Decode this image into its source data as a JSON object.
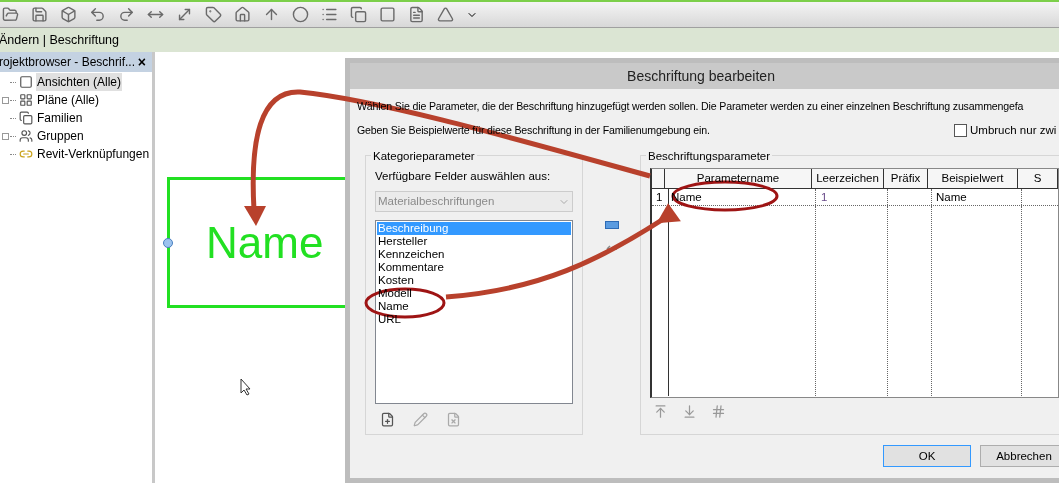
{
  "ribbon": {
    "context_tab": "Ändern | Beschriftung"
  },
  "project_browser": {
    "title": "rojektbrowser - Beschrif...",
    "close": "×",
    "items": [
      {
        "label": "Ansichten (Alle)",
        "kind": "views",
        "expandable": false,
        "selected": true
      },
      {
        "label": "Pläne (Alle)",
        "kind": "sheets",
        "expandable": true,
        "selected": false
      },
      {
        "label": "Familien",
        "kind": "families",
        "expandable": false,
        "selected": false
      },
      {
        "label": "Gruppen",
        "kind": "groups",
        "expandable": true,
        "selected": false
      },
      {
        "label": "Revit-Verknüpfungen",
        "kind": "links",
        "expandable": false,
        "selected": false
      }
    ]
  },
  "canvas": {
    "label_text": "Name"
  },
  "dialog": {
    "title": "Beschriftung bearbeiten",
    "instructions": [
      "Wählen Sie die Parameter, die der Beschriftung hinzugefügt werden sollen. Die Parameter werden zu einer einzelnen Beschriftung zusammengefa",
      "Geben Sie Beispielwerte für diese Beschriftung in der Familienumgebung ein."
    ],
    "wrap_checkbox": {
      "label": "Umbruch nur zwi",
      "checked": false
    },
    "category_parameters": {
      "title": "Kategorieparameter",
      "dropdown_label": "Verfügbare Felder auswählen aus:",
      "dropdown": {
        "value": "Materialbeschriftungen",
        "disabled": true
      },
      "fields": [
        {
          "label": "Beschreibung",
          "selected": true
        },
        {
          "label": "Hersteller",
          "selected": false
        },
        {
          "label": "Kennzeichen",
          "selected": false
        },
        {
          "label": "Kommentare",
          "selected": false
        },
        {
          "label": "Kosten",
          "selected": false
        },
        {
          "label": "Modell",
          "selected": false
        },
        {
          "label": "Name",
          "selected": false
        },
        {
          "label": "URL",
          "selected": false
        }
      ]
    },
    "label_parameters": {
      "title": "Beschriftungsparameter",
      "columns": [
        "Parametername",
        "Leerzeichen",
        "Präfix",
        "Beispielwert",
        "S"
      ],
      "rows": [
        {
          "number": "1",
          "parameter_name": "Name",
          "spaces": "1",
          "example_value": "Name"
        }
      ]
    },
    "buttons": [
      {
        "label": "OK",
        "default": true
      },
      {
        "label": "Abbrechen",
        "default": false
      }
    ]
  }
}
